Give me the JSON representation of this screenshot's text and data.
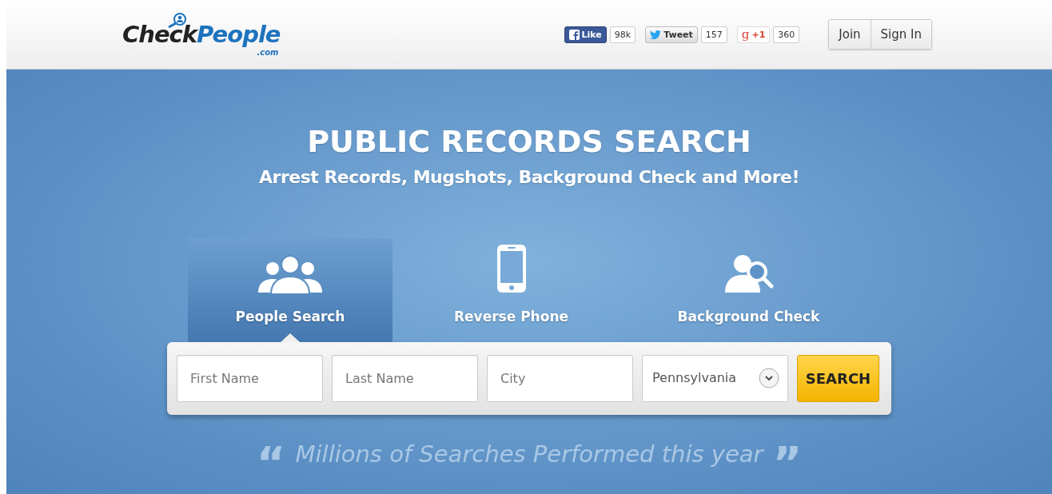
{
  "logo": {
    "first": "Check",
    "second": "People",
    "suffix": ".com"
  },
  "social": [
    {
      "kind": "facebook",
      "label": "Like",
      "count": "98k"
    },
    {
      "kind": "twitter",
      "label": "Tweet",
      "count": "157"
    },
    {
      "kind": "gplus",
      "icon": "g",
      "label": "+1",
      "count": "360"
    }
  ],
  "auth_buttons": [
    "Join",
    "Sign In"
  ],
  "hero": {
    "title": "PUBLIC RECORDS SEARCH",
    "subtitle": "Arrest Records, Mugshots, Background Check and More!"
  },
  "tabs": [
    {
      "kind": "people",
      "label": "People Search",
      "selected": true
    },
    {
      "kind": "phone",
      "label": "Reverse Phone",
      "selected": false
    },
    {
      "kind": "background",
      "label": "Background Check",
      "selected": false
    }
  ],
  "search": {
    "fields": [
      {
        "placeholder": "First Name"
      },
      {
        "placeholder": "Last Name"
      },
      {
        "placeholder": "City"
      }
    ],
    "state": "Pennsylvania",
    "button": "SEARCH"
  },
  "quote": {
    "open": "“",
    "text": "Millions of Searches Performed this year",
    "close": "”"
  }
}
